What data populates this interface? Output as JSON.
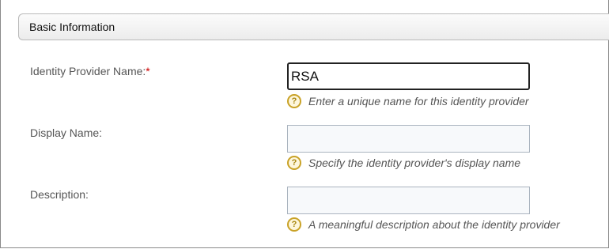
{
  "section": {
    "title": "Basic Information"
  },
  "fields": [
    {
      "label": "Identity Provider Name:",
      "required_marker": "*",
      "value": "RSA",
      "help_icon": "help-icon",
      "help_text": "Enter a unique name for this identity provider"
    },
    {
      "label": "Display Name:",
      "value": "",
      "help_icon": "help-icon",
      "help_text": "Specify the identity provider's display name"
    },
    {
      "label": "Description:",
      "value": "",
      "help_icon": "help-icon",
      "help_text": "A meaningful description about the identity provider"
    }
  ],
  "colors": {
    "required": "#cc0000",
    "help_icon": "#c9a227",
    "input_border": "#aab4bf"
  }
}
